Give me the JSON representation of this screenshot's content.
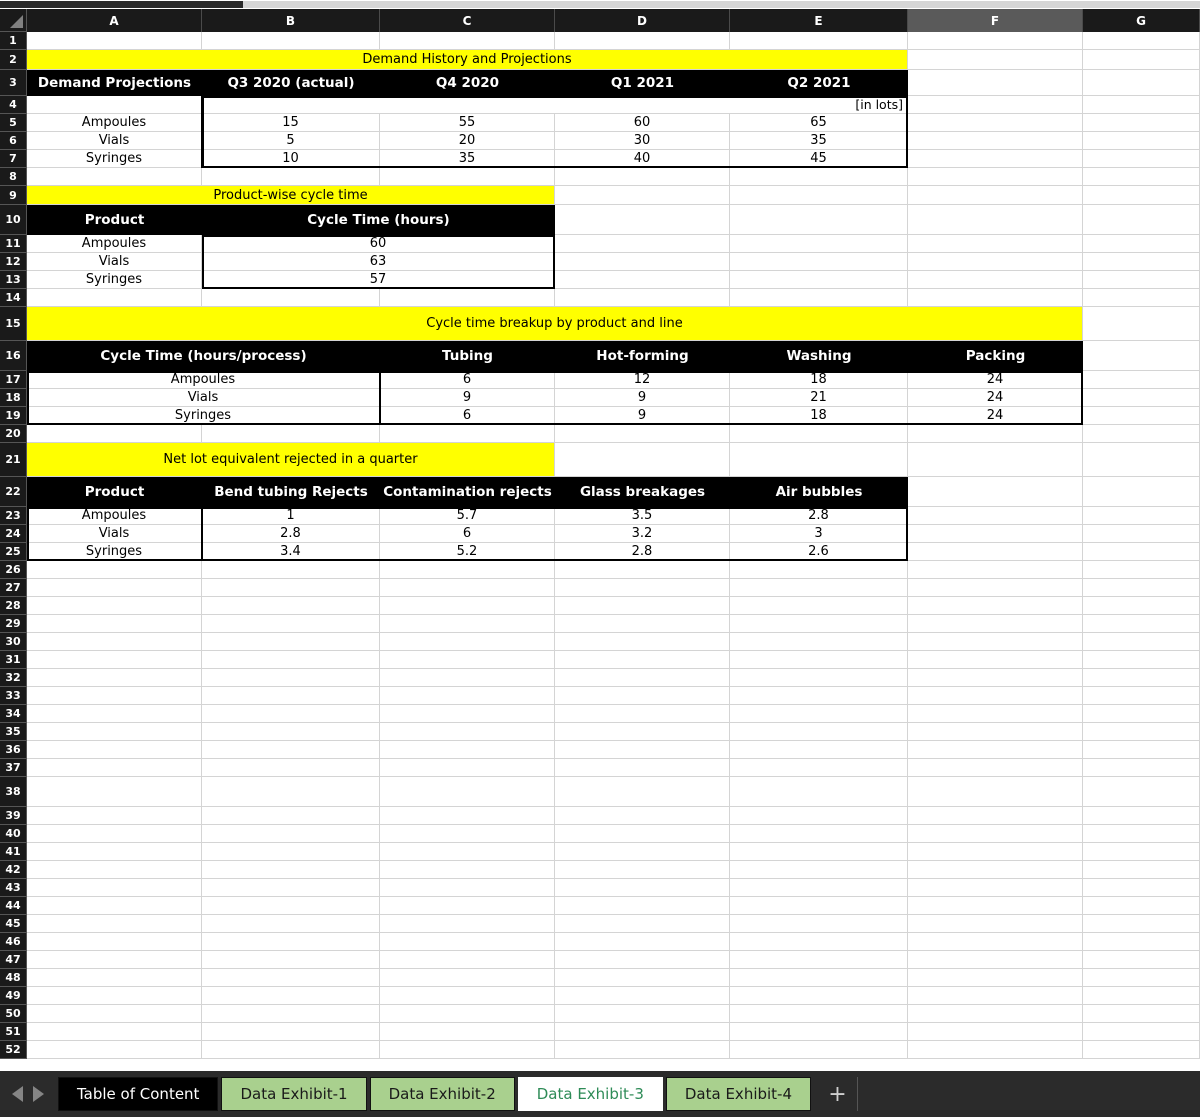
{
  "window": {
    "columns": [
      "A",
      "B",
      "C",
      "D",
      "E",
      "F",
      "G"
    ],
    "selected_column": "F",
    "rows": [
      1,
      2,
      3,
      4,
      5,
      6,
      7,
      8,
      9,
      10,
      11,
      12,
      13,
      14,
      15,
      16,
      17,
      18,
      19,
      20,
      21,
      22,
      23,
      24,
      25,
      26,
      27,
      28,
      29,
      30,
      31,
      32,
      33,
      34,
      35,
      36,
      37,
      38,
      39,
      40,
      41,
      42,
      43,
      44,
      45,
      46,
      47,
      48,
      49,
      50,
      51,
      52
    ]
  },
  "tables": {
    "demand": {
      "banner": "Demand History and Projections",
      "unit_note": "[in lots]",
      "headers": [
        "Demand Projections",
        "Q3 2020 (actual)",
        "Q4 2020",
        "Q1 2021",
        "Q2 2021"
      ],
      "rows": [
        {
          "product": "Ampoules",
          "values": [
            "15",
            "55",
            "60",
            "65"
          ]
        },
        {
          "product": "Vials",
          "values": [
            "5",
            "20",
            "30",
            "35"
          ]
        },
        {
          "product": "Syringes",
          "values": [
            "10",
            "35",
            "40",
            "45"
          ]
        }
      ]
    },
    "cycle_time": {
      "banner": "Product-wise cycle time",
      "headers": [
        "Product",
        "Cycle Time (hours)"
      ],
      "rows": [
        {
          "product": "Ampoules",
          "values": [
            "60"
          ]
        },
        {
          "product": "Vials",
          "values": [
            "63"
          ]
        },
        {
          "product": "Syringes",
          "values": [
            "57"
          ]
        }
      ]
    },
    "cycle_breakup": {
      "banner": "Cycle time breakup by product and line",
      "headers": [
        "Cycle Time (hours/process)",
        "Tubing",
        "Hot-forming",
        "Washing",
        "Packing"
      ],
      "rows": [
        {
          "product": "Ampoules",
          "values": [
            "6",
            "12",
            "18",
            "24"
          ]
        },
        {
          "product": "Vials",
          "values": [
            "9",
            "9",
            "21",
            "24"
          ]
        },
        {
          "product": "Syringes",
          "values": [
            "6",
            "9",
            "18",
            "24"
          ]
        }
      ]
    },
    "rejects": {
      "banner": "Net lot equivalent rejected in a quarter",
      "headers": [
        "Product",
        "Bend tubing Rejects",
        "Contamination rejects",
        "Glass breakages",
        "Air bubbles"
      ],
      "rows": [
        {
          "product": "Ampoules",
          "values": [
            "1",
            "5.7",
            "3.5",
            "2.8"
          ]
        },
        {
          "product": "Vials",
          "values": [
            "2.8",
            "6",
            "3.2",
            "3"
          ]
        },
        {
          "product": "Syringes",
          "values": [
            "3.4",
            "5.2",
            "2.8",
            "2.6"
          ]
        }
      ]
    }
  },
  "tabbar": {
    "prev_label": "◀",
    "next_label": "▶",
    "add_label": "+",
    "tabs": [
      {
        "label": "Table of Content",
        "style": "toc",
        "active": false
      },
      {
        "label": "Data Exhibit-1",
        "style": "green",
        "active": false
      },
      {
        "label": "Data Exhibit-2",
        "style": "green",
        "active": false
      },
      {
        "label": "Data Exhibit-3",
        "style": "active",
        "active": true
      },
      {
        "label": "Data Exhibit-4",
        "style": "green",
        "active": false
      }
    ]
  },
  "colors": {
    "banner": "#ffff00",
    "header": "#000000",
    "accent_green": "#217346",
    "tab_green": "#a9d08e"
  }
}
